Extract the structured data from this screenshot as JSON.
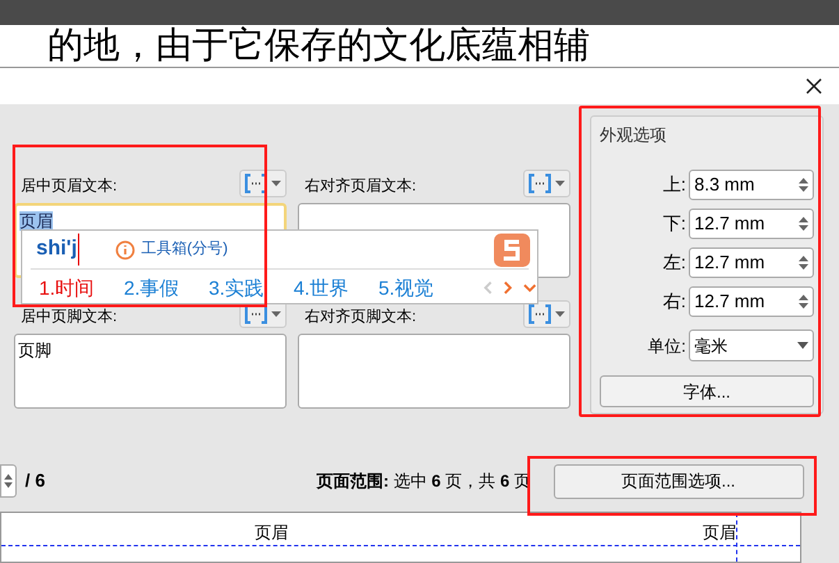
{
  "background_document": {
    "text": "的地，由于它保存的文化底蕴相辅"
  },
  "header_fields": [
    {
      "label": "居中页眉文本:",
      "value": "页眉",
      "focused": true,
      "value_selected": true
    },
    {
      "label": "右对齐页眉文本:",
      "focused": false
    }
  ],
  "footer_fields": [
    {
      "label": "居中页脚文本:",
      "value": "页脚",
      "focused": false
    },
    {
      "label": "右对齐页脚文本:",
      "focused": false
    }
  ],
  "ime": {
    "input": "shi'j",
    "hint": "工具箱(分号)",
    "candidates": [
      {
        "label": "1.时间",
        "selected": true
      },
      {
        "label": "2.事假",
        "selected": false
      },
      {
        "label": "3.实践",
        "selected": false
      },
      {
        "label": "4.世界",
        "selected": false
      },
      {
        "label": "5.视觉",
        "selected": false
      }
    ]
  },
  "appearance": {
    "title": "外观选项",
    "margins": [
      {
        "label": "上:",
        "value": "8.3 mm"
      },
      {
        "label": "下:",
        "value": "12.7 mm"
      },
      {
        "label": "左:",
        "value": "12.7 mm"
      },
      {
        "label": "右:",
        "value": "12.7 mm"
      }
    ],
    "unit": {
      "label": "单位:",
      "value": "毫米"
    },
    "font_button": "字体..."
  },
  "pager": {
    "total": "/ 6"
  },
  "page_range": {
    "text": "**页面范围:** 选中 **6** 页，共 **6** 页",
    "button": "页面范围选项..."
  },
  "preview": {
    "header_texts": [
      "页眉",
      "页眉"
    ]
  }
}
